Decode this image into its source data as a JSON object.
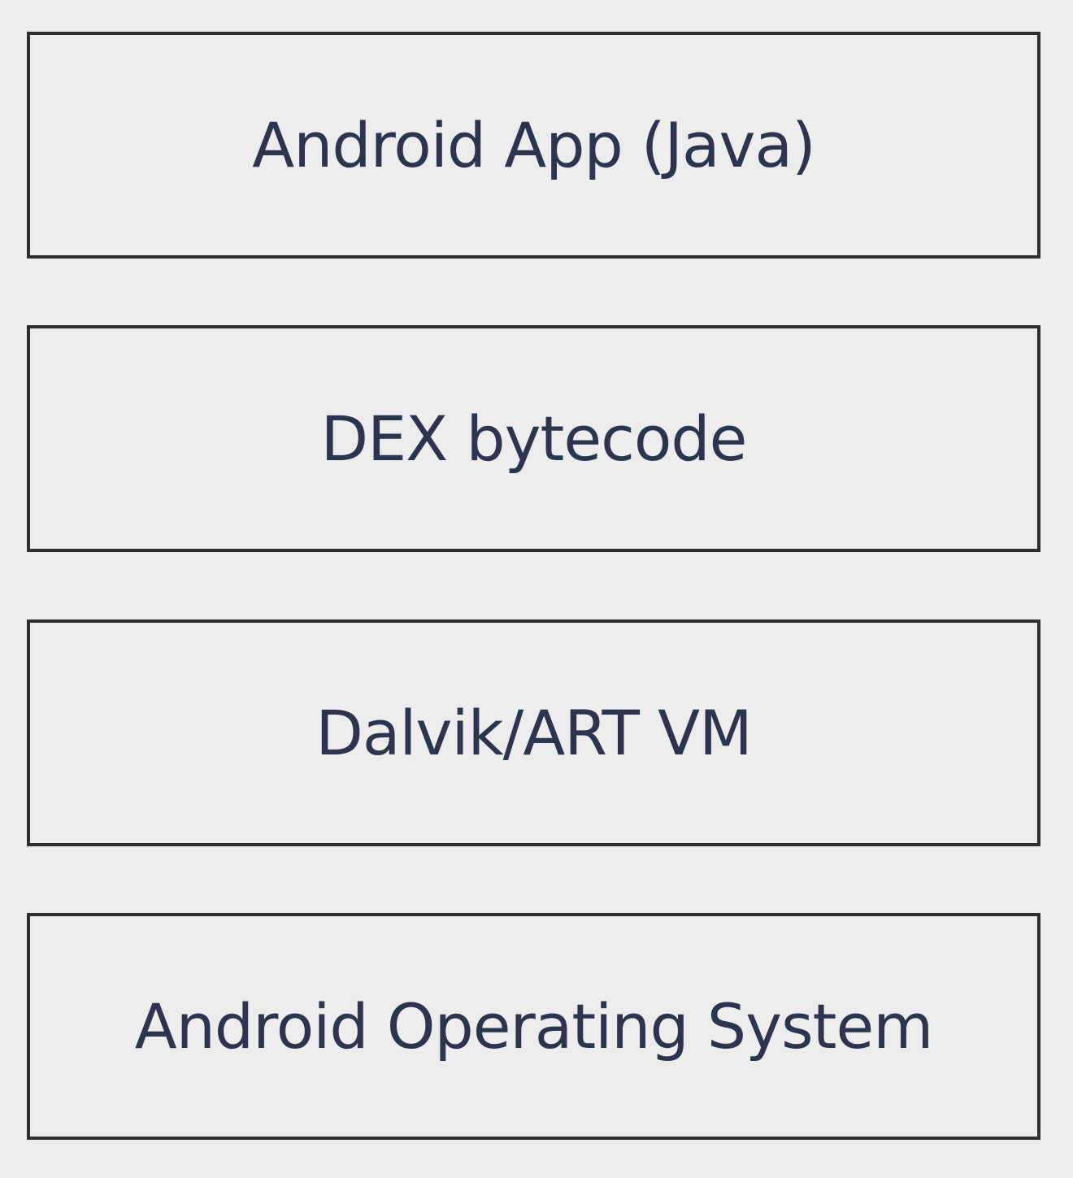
{
  "diagram": {
    "layers": [
      {
        "label": "Android App (Java)"
      },
      {
        "label": "DEX bytecode"
      },
      {
        "label": "Dalvik/ART VM"
      },
      {
        "label": "Android Operating System"
      }
    ]
  }
}
